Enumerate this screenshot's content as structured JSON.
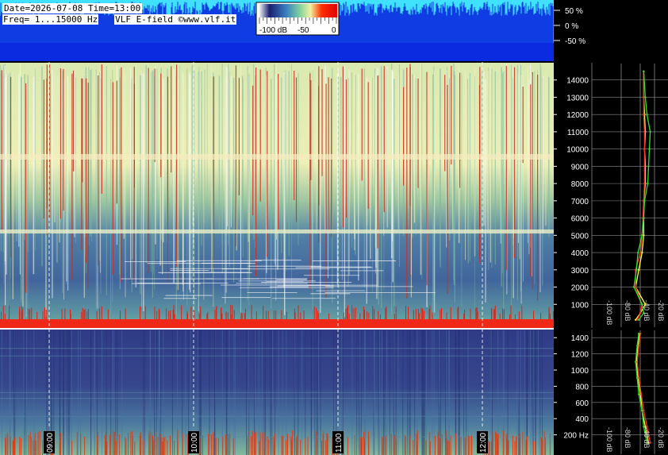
{
  "header": {
    "datetime": "Date=2026-07-08 Time=13:00",
    "freq": "Freq= 1...15000 Hz",
    "source": "VLF E-field ©www.vlf.it"
  },
  "colorbar": {
    "labels": [
      "-100 dB",
      "-50",
      "0"
    ],
    "stops": [
      "#ffffff",
      "#1a1f6e",
      "#3a7fc0",
      "#7fd0a0",
      "#f0f0a0",
      "#ff3000"
    ]
  },
  "waveform": {
    "scale_labels": [
      "50 %",
      "0 %",
      "-50 %"
    ],
    "color": "#0b2be0",
    "background": "#40e0ff"
  },
  "chart_data": [
    {
      "type": "heatmap",
      "title": "",
      "xlabel": "",
      "ylabel": "",
      "x_ticks": [
        "09:00",
        "10:00",
        "11:00",
        "12:00"
      ],
      "upper_panel": {
        "ylim": [
          0,
          15000
        ],
        "y_ticks": [
          "1000",
          "2000",
          "3000",
          "4000",
          "5000",
          "6000",
          "7000",
          "8000",
          "9000",
          "10000",
          "11000",
          "12000",
          "13000",
          "14000"
        ]
      },
      "lower_panel": {
        "ylim": [
          0,
          1500
        ],
        "y_ticks": [
          "200 Hz",
          "400",
          "600",
          "800",
          "1000",
          "1200",
          "1400"
        ]
      }
    },
    {
      "type": "line",
      "title": "",
      "xlabel": "",
      "x_ticks": [
        "-100 dB",
        "-80 dB",
        "-40 dB",
        "-20 dB"
      ],
      "y_ticks": [
        "1000",
        "2000",
        "3000",
        "4000",
        "5000",
        "6000",
        "7000",
        "8000",
        "9000",
        "10000",
        "11000",
        "12000",
        "13000",
        "14000"
      ],
      "ylim": [
        0,
        15000
      ],
      "xlim": [
        -100,
        -10
      ],
      "series": [
        {
          "color": "#ffff40",
          "x": [
            -48,
            -42,
            -36,
            -48,
            -44,
            -40,
            -38,
            -38,
            -38,
            -36,
            -36,
            -37,
            -36,
            -37,
            -38,
            -38
          ],
          "y": [
            100,
            500,
            1000,
            2000,
            3000,
            4000,
            5000,
            6000,
            7000,
            8000,
            9000,
            10000,
            11000,
            12000,
            13000,
            14500
          ]
        },
        {
          "color": "#ff3030",
          "x": [
            -46,
            -42,
            -40,
            -48,
            -48,
            -42,
            -40,
            -39,
            -38,
            -37,
            -37,
            -37,
            -37,
            -38,
            -38,
            -38
          ],
          "y": [
            100,
            500,
            1000,
            2000,
            3000,
            4000,
            5000,
            6000,
            7000,
            8000,
            9000,
            10000,
            11000,
            12000,
            13000,
            14500
          ]
        },
        {
          "color": "#30e030",
          "x": [
            -44,
            -38,
            -40,
            -50,
            -47,
            -45,
            -40,
            -38,
            -37,
            -33,
            -32,
            -31,
            -30,
            -34,
            -36,
            -38
          ],
          "y": [
            100,
            500,
            1000,
            2000,
            3000,
            4000,
            5000,
            6000,
            7000,
            8000,
            9000,
            10000,
            11000,
            12000,
            13000,
            14500
          ]
        }
      ]
    },
    {
      "type": "line",
      "title": "",
      "xlabel": "",
      "x_ticks": [
        "-100 dB",
        "-80 dB",
        "-40 dB",
        "-20 dB"
      ],
      "y_ticks": [
        "200 Hz",
        "400",
        "600",
        "800",
        "1000",
        "1200",
        "1400"
      ],
      "ylim": [
        0,
        1500
      ],
      "xlim": [
        -100,
        -10
      ],
      "series": [
        {
          "color": "#ffff40",
          "x": [
            -32,
            -36,
            -40,
            -42,
            -45,
            -47,
            -45,
            -43
          ],
          "y": [
            100,
            300,
            500,
            700,
            900,
            1100,
            1300,
            1450
          ]
        },
        {
          "color": "#ff3030",
          "x": [
            -30,
            -34,
            -38,
            -41,
            -44,
            -46,
            -44,
            -42
          ],
          "y": [
            100,
            300,
            500,
            700,
            900,
            1100,
            1300,
            1450
          ]
        },
        {
          "color": "#30e030",
          "x": [
            -34,
            -38,
            -40,
            -44,
            -46,
            -48,
            -46,
            -44
          ],
          "y": [
            100,
            300,
            500,
            700,
            900,
            1100,
            1300,
            1450
          ]
        }
      ]
    }
  ]
}
